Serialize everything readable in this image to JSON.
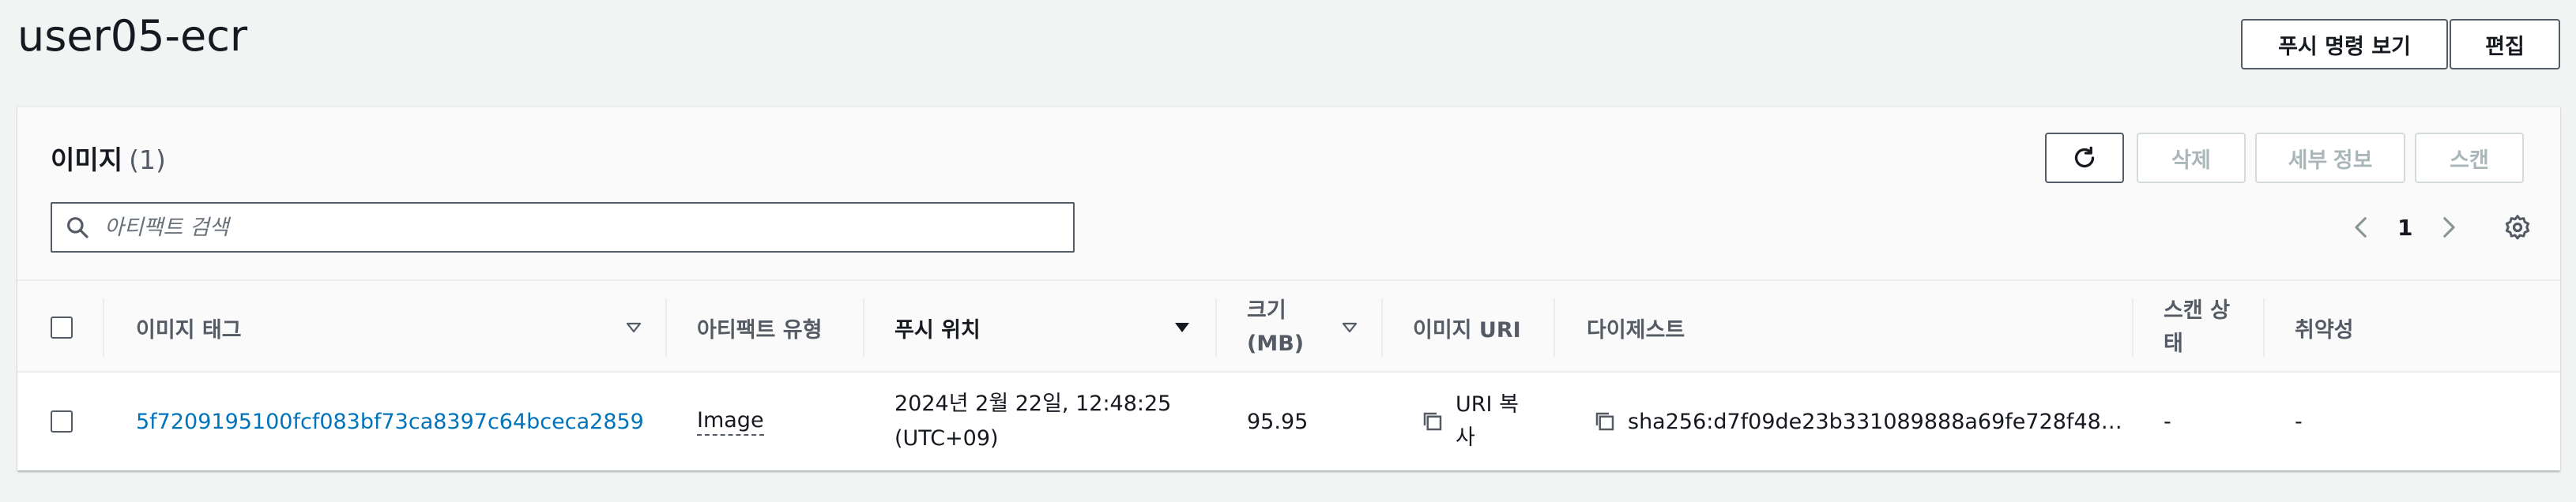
{
  "page": {
    "title": "user05-ecr",
    "view_push_commands": "푸시 명령 보기",
    "edit": "편집"
  },
  "panel": {
    "title": "이미지",
    "count": "(1)",
    "buttons": {
      "delete": "삭제",
      "details": "세부 정보",
      "scan": "스캔"
    },
    "search_placeholder": "아티팩트 검색",
    "page_number": "1"
  },
  "columns": {
    "image_tag": "이미지 태그",
    "artifact_type": "아티팩트 유형",
    "pushed_at": "푸시 위치",
    "size_l1": "크기",
    "size_l2": "(MB)",
    "image_uri": "이미지 URI",
    "digest": "다이제스트",
    "scan_status_l1": "스캔 상",
    "scan_status_l2": "태",
    "vulnerabilities": "취약성"
  },
  "rows": [
    {
      "image_tag": "5f7209195100fcf083bf73ca8397c64bceca2859",
      "artifact_type": "Image",
      "pushed_at_l1": "2024년 2월 22일, 12:48:25",
      "pushed_at_l2": "(UTC+09)",
      "size": "95.95",
      "uri_copy_l1": "URI 복",
      "uri_copy_l2": "사",
      "digest": "sha256:d7f09de23b331089888a69fe728f48…",
      "scan_status": "-",
      "vulnerabilities": "-"
    }
  ],
  "icons": [
    "refresh-icon",
    "search-icon",
    "chevron-left-icon",
    "chevron-right-icon",
    "settings-icon",
    "sort-icon",
    "copy-icon"
  ],
  "colors": {
    "link": "#0073bb",
    "text": "#16191f",
    "muted": "#545b64",
    "disabled": "#aab7b8",
    "background": "#f2f3f3"
  }
}
